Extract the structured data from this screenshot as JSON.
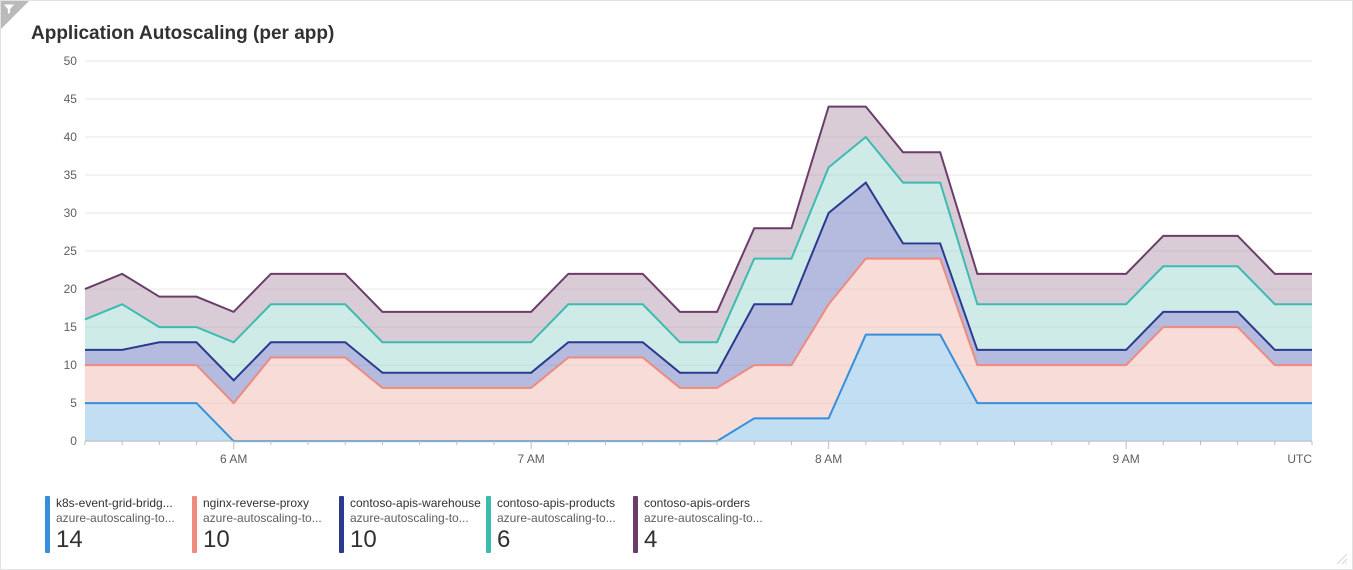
{
  "title": "Application Autoscaling (per app)",
  "x_unit_label": "UTC",
  "y_ticks": [
    0,
    5,
    10,
    15,
    20,
    25,
    30,
    35,
    40,
    45,
    50
  ],
  "x_ticks": [
    {
      "index": 4,
      "label": "6 AM"
    },
    {
      "index": 12,
      "label": "7 AM"
    },
    {
      "index": 20,
      "label": "8 AM"
    },
    {
      "index": 28,
      "label": "9 AM"
    }
  ],
  "legend": [
    {
      "name": "k8s-event-grid-bridg...",
      "sub": "azure-autoscaling-to...",
      "value": "14",
      "color": "#358fdb"
    },
    {
      "name": "nginx-reverse-proxy",
      "sub": "azure-autoscaling-to...",
      "value": "10",
      "color": "#ef8a7f"
    },
    {
      "name": "contoso-apis-warehouse",
      "sub": "azure-autoscaling-to...",
      "value": "10",
      "color": "#2b3a8f"
    },
    {
      "name": "contoso-apis-products",
      "sub": "azure-autoscaling-to...",
      "value": "6",
      "color": "#3cbbb1"
    },
    {
      "name": "contoso-apis-orders",
      "sub": "azure-autoscaling-to...",
      "value": "4",
      "color": "#6b3d6a"
    }
  ],
  "chart_data": {
    "type": "area",
    "title": "Application Autoscaling (per app)",
    "xlabel": "",
    "ylabel": "",
    "ylim": [
      0,
      50
    ],
    "x_unit": "UTC",
    "categories": [
      "5:30",
      "5:37.5",
      "5:45",
      "5:52.5",
      "6:00",
      "6:07.5",
      "6:15",
      "6:22.5",
      "6:30",
      "6:37.5",
      "6:45",
      "6:52.5",
      "7:00",
      "7:07.5",
      "7:15",
      "7:22.5",
      "7:30",
      "7:37.5",
      "7:45",
      "7:52.5",
      "8:00",
      "8:07.5",
      "8:15",
      "8:22.5",
      "8:30",
      "8:37.5",
      "8:45",
      "8:52.5",
      "9:00",
      "9:07.5",
      "9:15",
      "9:22.5",
      "9:30",
      "9:37.5"
    ],
    "series": [
      {
        "name": "k8s-event-grid-bridg...",
        "color": "#8fc3ea",
        "stroke": "#358fdb",
        "values": [
          5,
          5,
          5,
          5,
          0,
          0,
          0,
          0,
          0,
          0,
          0,
          0,
          0,
          0,
          0,
          0,
          0,
          0,
          3,
          3,
          3,
          14,
          14,
          14,
          5,
          5,
          5,
          5,
          5,
          5,
          5,
          5,
          5,
          5
        ]
      },
      {
        "name": "nginx-reverse-proxy",
        "color": "#f2bfb7",
        "stroke": "#ef8a7f",
        "values": [
          5,
          5,
          5,
          5,
          5,
          11,
          11,
          11,
          7,
          7,
          7,
          7,
          7,
          11,
          11,
          11,
          7,
          7,
          7,
          7,
          15,
          10,
          10,
          10,
          5,
          5,
          5,
          5,
          5,
          10,
          10,
          10,
          5,
          5
        ]
      },
      {
        "name": "contoso-apis-warehouse",
        "color": "#7983c3",
        "stroke": "#2b3a8f",
        "values": [
          2,
          2,
          3,
          3,
          3,
          2,
          2,
          2,
          2,
          2,
          2,
          2,
          2,
          2,
          2,
          2,
          2,
          2,
          8,
          8,
          12,
          10,
          2,
          2,
          2,
          2,
          2,
          2,
          2,
          2,
          2,
          2,
          2,
          2
        ]
      },
      {
        "name": "contoso-apis-products",
        "color": "#a5dbd5",
        "stroke": "#3cbbb1",
        "values": [
          4,
          6,
          2,
          2,
          5,
          5,
          5,
          5,
          4,
          4,
          4,
          4,
          4,
          5,
          5,
          5,
          4,
          4,
          6,
          6,
          6,
          6,
          8,
          8,
          6,
          6,
          6,
          6,
          6,
          6,
          6,
          6,
          6,
          6
        ]
      },
      {
        "name": "contoso-apis-orders",
        "color": "#bba2b7",
        "stroke": "#6b3d6a",
        "values": [
          4,
          4,
          4,
          4,
          4,
          4,
          4,
          4,
          4,
          4,
          4,
          4,
          4,
          4,
          4,
          4,
          4,
          4,
          4,
          4,
          8,
          4,
          4,
          4,
          4,
          4,
          4,
          4,
          4,
          4,
          4,
          4,
          4,
          4
        ]
      }
    ]
  }
}
